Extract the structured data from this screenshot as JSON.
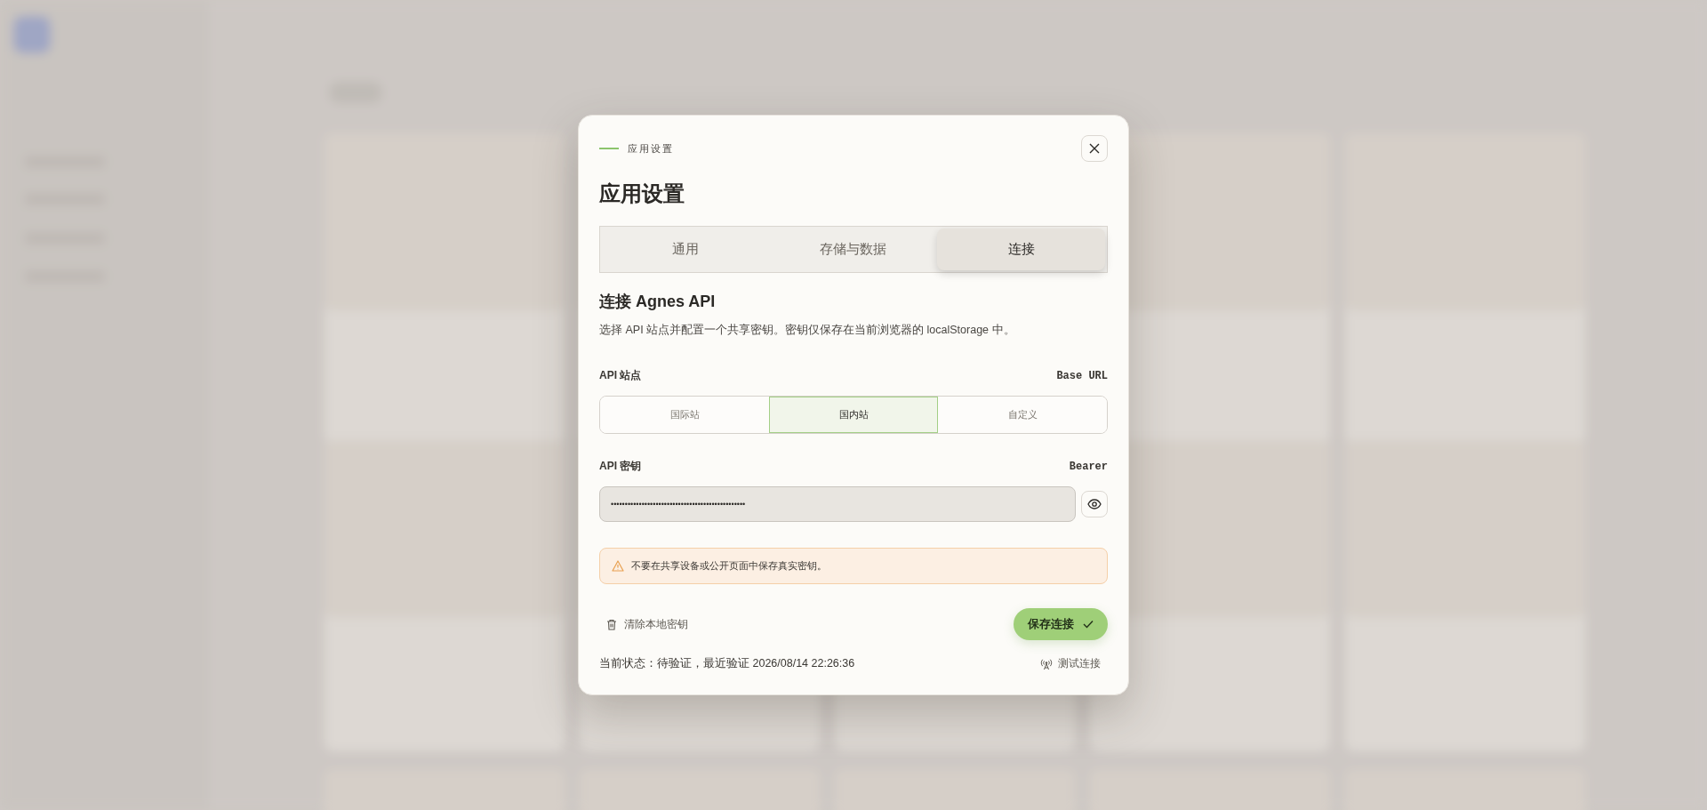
{
  "dialog": {
    "eyebrow": "应用设置",
    "title": "应用设置",
    "tabs": [
      {
        "label": "通用",
        "selected": false
      },
      {
        "label": "存储与数据",
        "selected": false
      },
      {
        "label": "连接",
        "selected": true
      }
    ],
    "section_title": "连接 Agnes API",
    "description": "选择 API 站点并配置一个共享密钥。密钥仅保存在当前浏览器的 localStorage 中。",
    "endpoint": {
      "label": "API 站点",
      "hint": "Base URL",
      "options": [
        {
          "label": "国际站",
          "selected": false
        },
        {
          "label": "国内站",
          "selected": true
        },
        {
          "label": "自定义",
          "selected": false
        }
      ]
    },
    "api_key": {
      "label": "API 密钥",
      "hint": "Bearer",
      "value": "••••••••••••••••••••••••••••••••••••••••••••••••"
    },
    "warning": "不要在共享设备或公开页面中保存真实密钥。",
    "clear_button": "清除本地密钥",
    "save_button": "保存连接",
    "status": "当前状态：待验证，最近验证 2026/08/14 22:26:36",
    "test_button": "测试连接"
  }
}
